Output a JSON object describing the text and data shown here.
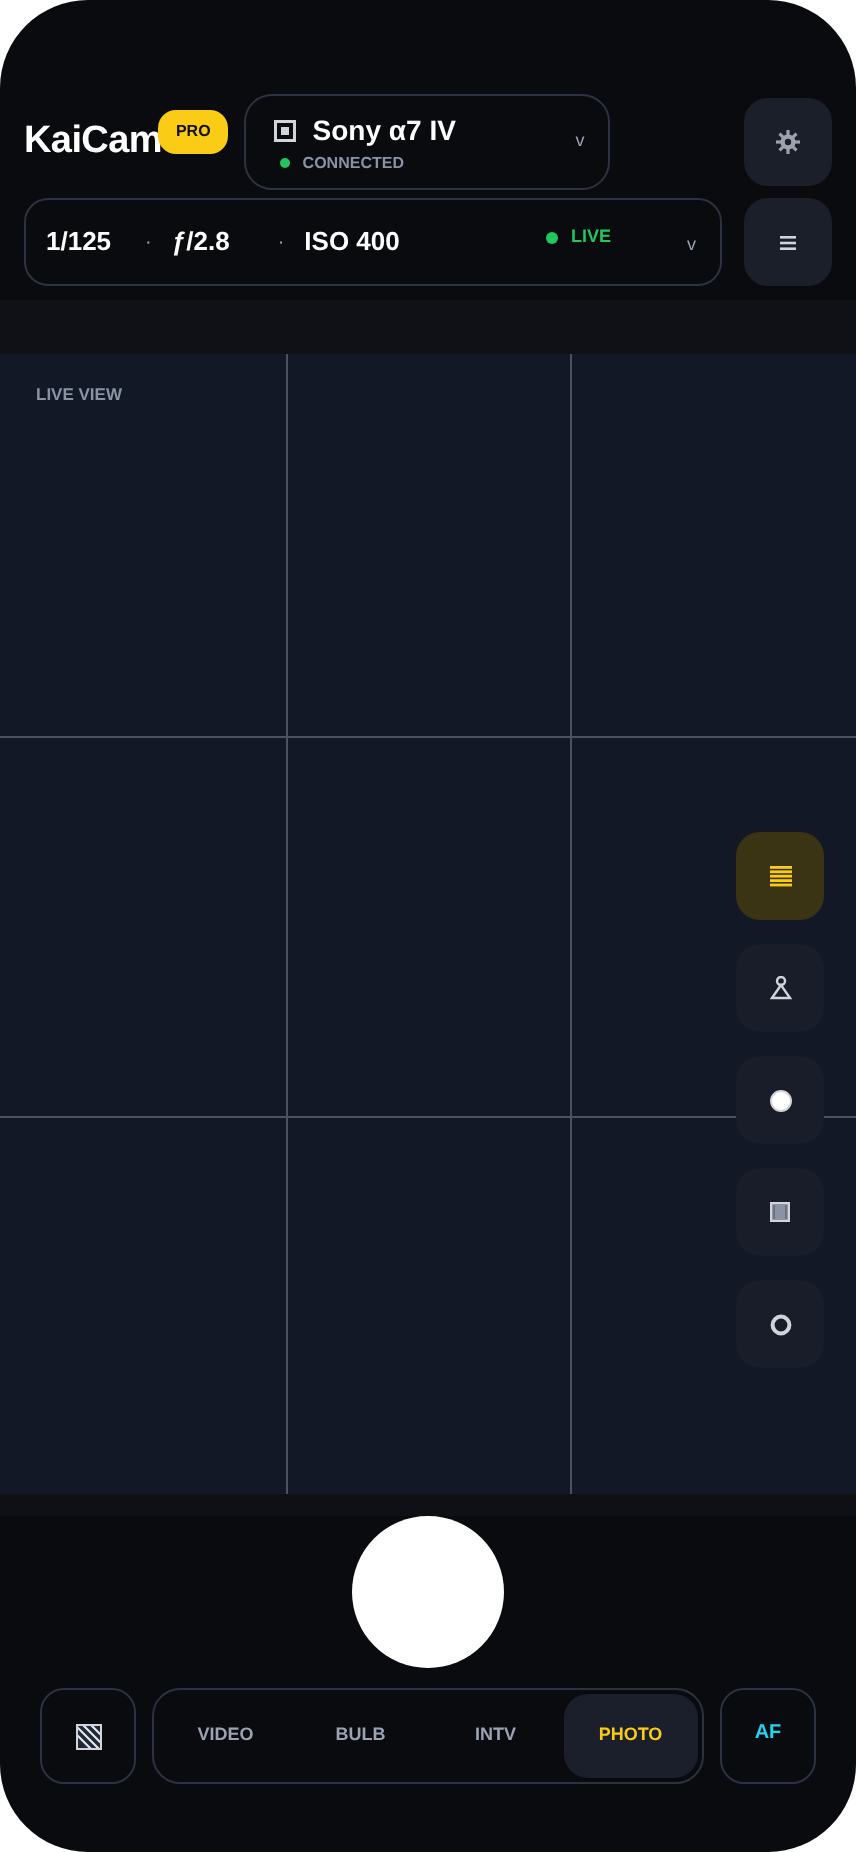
{
  "app": {
    "name": "KaiCam",
    "badge": "PRO"
  },
  "camera": {
    "name": "Sony α7 IV",
    "status": "CONNECTED",
    "connected": true,
    "caret": "v"
  },
  "exposure": {
    "items": [
      "1/125",
      "ƒ/2.8",
      "ISO 400"
    ],
    "separator": "·",
    "live": {
      "label": "LIVE",
      "on": true
    },
    "caret": "v"
  },
  "viewfinder": {
    "label": "LIVE VIEW",
    "grid": true
  },
  "tools": [
    {
      "kind": "grid",
      "selected": true
    },
    {
      "kind": "pawn",
      "selected": false
    },
    {
      "kind": "dot",
      "selected": false
    },
    {
      "kind": "frame",
      "selected": false
    },
    {
      "kind": "ring",
      "selected": false
    }
  ],
  "modes": [
    {
      "label": "VIDEO",
      "selected": false
    },
    {
      "label": "BULB",
      "selected": false
    },
    {
      "label": "INTV",
      "selected": false
    },
    {
      "label": "PHOTO",
      "selected": true
    }
  ],
  "focus": {
    "label": "AF"
  }
}
